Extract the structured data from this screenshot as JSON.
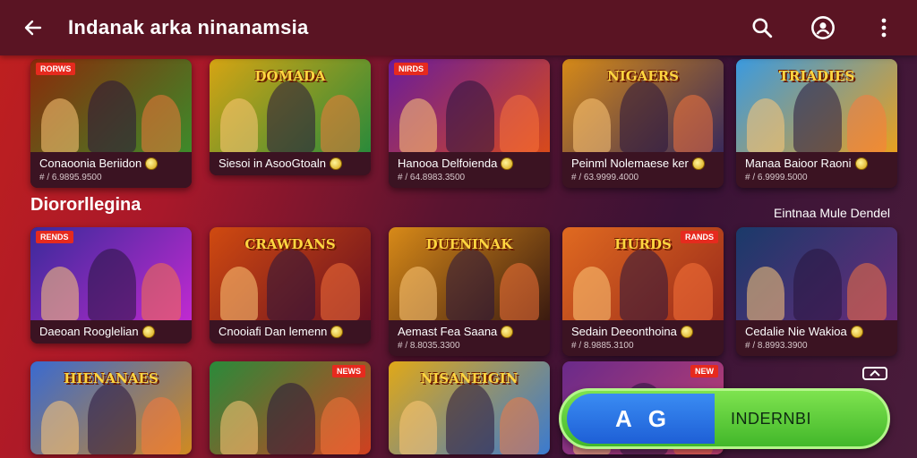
{
  "appbar": {
    "title": "Indanak arka ninanamsia",
    "back_icon": "arrow-left-icon",
    "actions": [
      "search-icon",
      "account-icon",
      "more-vert-icon"
    ]
  },
  "row1": [
    {
      "name": "Conaoonia Beriidon",
      "price": "# / 6.9895.9500",
      "badge": "RORWS",
      "headline": "",
      "bg1": "#8a2a0a",
      "bg2": "#3d8a2a"
    },
    {
      "name": "Siesoi in AsooGtoaln",
      "price": "",
      "badge": "",
      "headline": "DOMADA",
      "bg1": "#d6a413",
      "bg2": "#2a8a3a"
    },
    {
      "name": "Hanooa Delfoienda",
      "price": "# / 64.8983.3500",
      "badge": "NIRDS",
      "headline": "",
      "bg1": "#6a1c9a",
      "bg2": "#d84a1a"
    },
    {
      "name": "Peinml Nolemaese ker",
      "price": "# / 63.9999.4000",
      "badge": "",
      "headline": "NIGAERS",
      "bg1": "#d68a18",
      "bg2": "#3a2a5a"
    },
    {
      "name": "Manaa Baioor Raoni",
      "price": "# / 6.9999.5000",
      "badge": "",
      "headline": "TRIADIES",
      "bg1": "#3a9ae0",
      "bg2": "#e8a020"
    }
  ],
  "section": {
    "title": "Diororllegina",
    "link": "Eintnaa Mule Dendel"
  },
  "row2": [
    {
      "name": "Daeoan Rooglelian",
      "price": "",
      "badge": "RENDS",
      "headline": "",
      "bg1": "#3a2a9a",
      "bg2": "#c02ad0"
    },
    {
      "name": "Cnooiafi Dan lemenn",
      "price": "",
      "badge": "",
      "headline": "CRAWDANS",
      "bg1": "#d04a10",
      "bg2": "#6a1020"
    },
    {
      "name": "Aemast Fea Saana",
      "price": "# / 8.8035.3300",
      "badge": "",
      "headline": "DUENINAK",
      "bg1": "#d88a18",
      "bg2": "#3a1a10"
    },
    {
      "name": "Sedain Deeonthoina",
      "price": "# / 8.9885.3100",
      "badge": "RANDS",
      "headline": "HURDS",
      "bg1": "#e06a20",
      "bg2": "#9a2a1a"
    },
    {
      "name": "Cedalie Nie Wakioa",
      "price": "# / 8.8993.3900",
      "badge": "",
      "headline": "",
      "bg1": "#1a3a6a",
      "bg2": "#6a2a7a"
    }
  ],
  "row3": [
    {
      "badge": "",
      "headline": "HIENANAES",
      "bg1": "#3a6ad0",
      "bg2": "#d08a20"
    },
    {
      "badge": "NEWS",
      "headline": "",
      "bg1": "#2a8a3a",
      "bg2": "#d04020"
    },
    {
      "badge": "",
      "headline": "NISANEIGIN",
      "bg1": "#e0a818",
      "bg2": "#3a7ad0"
    },
    {
      "badge": "NEW",
      "headline": "",
      "bg1": "#6a2a8a",
      "bg2": "#c04070"
    }
  ],
  "install": {
    "left_letters": "A",
    "left_symbol": "G",
    "label": "INDERNBI"
  },
  "colors": {
    "appbar": "#5a1423",
    "accent": "#42b72a",
    "badge": "#e62a1e"
  }
}
